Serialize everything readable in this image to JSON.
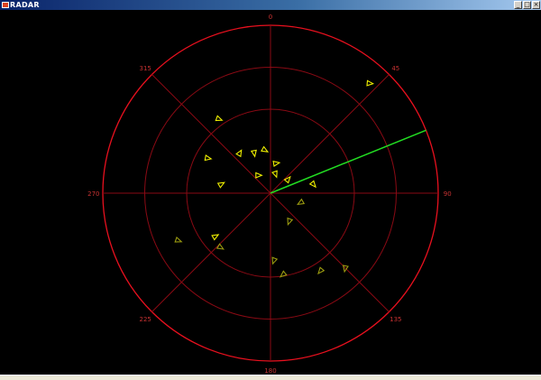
{
  "window": {
    "title": "RADAR",
    "minimize_glyph": "_",
    "maximize_glyph": "□",
    "close_glyph": "×"
  },
  "radar": {
    "bearing_labels": [
      "0",
      "45",
      "90",
      "135",
      "180",
      "225",
      "270",
      "315"
    ],
    "bearings": [
      0,
      45,
      90,
      135,
      180,
      225,
      270,
      315
    ],
    "sweep_bearing_deg": 68,
    "colors": {
      "background": "#000000",
      "outer_ring": "#e8101e",
      "inner_rings": "#8a0a14",
      "spokes": "#8a0a14",
      "labels": "#c83232",
      "sweep": "#22dd22",
      "contact_bright": "#f0f000",
      "contact_dim": "#9a9a10"
    },
    "contacts": [
      {
        "bearing": 325,
        "range": 0.54,
        "heading": 110,
        "bright": true
      },
      {
        "bearing": 42,
        "range": 0.88,
        "heading": 95,
        "bright": true
      },
      {
        "bearing": 299,
        "range": 0.43,
        "heading": 100,
        "bright": true
      },
      {
        "bearing": 322,
        "range": 0.3,
        "heading": 30,
        "bright": true
      },
      {
        "bearing": 338,
        "range": 0.26,
        "heading": 170,
        "bright": true
      },
      {
        "bearing": 352,
        "range": 0.26,
        "heading": 120,
        "bright": true
      },
      {
        "bearing": 10,
        "range": 0.18,
        "heading": 80,
        "bright": true
      },
      {
        "bearing": 14,
        "range": 0.12,
        "heading": 160,
        "bright": true
      },
      {
        "bearing": 280,
        "range": 0.3,
        "heading": 60,
        "bright": true
      },
      {
        "bearing": 325,
        "range": 0.13,
        "heading": 90,
        "bright": true
      },
      {
        "bearing": 52,
        "range": 0.13,
        "heading": 40,
        "bright": true
      },
      {
        "bearing": 78,
        "range": 0.26,
        "heading": 140,
        "bright": true
      },
      {
        "bearing": 107,
        "range": 0.19,
        "heading": 240,
        "bright": false
      },
      {
        "bearing": 146,
        "range": 0.2,
        "heading": 200,
        "bright": false
      },
      {
        "bearing": 223,
        "range": 0.44,
        "heading": 120,
        "bright": false
      },
      {
        "bearing": 232,
        "range": 0.42,
        "heading": 60,
        "bright": true
      },
      {
        "bearing": 243,
        "range": 0.62,
        "heading": 110,
        "bright": false
      },
      {
        "bearing": 177,
        "range": 0.4,
        "heading": 200,
        "bright": false
      },
      {
        "bearing": 171,
        "range": 0.49,
        "heading": 230,
        "bright": false
      },
      {
        "bearing": 147,
        "range": 0.55,
        "heading": 220,
        "bright": false
      },
      {
        "bearing": 135,
        "range": 0.63,
        "heading": 190,
        "bright": false
      }
    ]
  }
}
